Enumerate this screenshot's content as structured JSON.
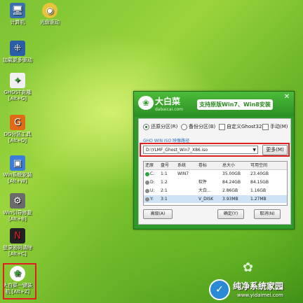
{
  "desktop": {
    "icons": [
      {
        "label": "计算机",
        "icon": "computer-icon"
      },
      {
        "label": "光盘驱动",
        "icon": "disc-icon"
      },
      {
        "label": "加载更多驱动",
        "icon": "grid-icon"
      },
      {
        "label": "GHOST克隆 [Alt+G]",
        "icon": "ghost-icon"
      },
      {
        "label": "DG分区工具 [Alt+D]",
        "icon": "dg-icon"
      },
      {
        "label": "Win系统安装 [Alt+W]",
        "icon": "windows-install-icon"
      },
      {
        "label": "Win引导修复 [Alt+B]",
        "icon": "repair-icon"
      },
      {
        "label": "登录密码清除 [Alt+C]",
        "icon": "password-clear-icon"
      },
      {
        "label": "大白菜一键装机 [Alt+Z]",
        "icon": "dabaicai-install-icon"
      }
    ]
  },
  "window": {
    "brand": "大白菜",
    "brand_sub": "dabaicai.com",
    "slogan": "支持原版Win7、Win8安装",
    "close_symbol": "✕",
    "options": {
      "restore": "还原分区(R)",
      "backup": "备份分区(B)",
      "custom_ghost": "自定义Ghost32",
      "manual": "手动(M)"
    },
    "path_label": "GHO WIN ISO 映像路径",
    "path_value": "D:\\YLMF_Ghost_Win7_X86.iso",
    "more_button": "更多(M)",
    "table": {
      "headers": [
        "还原",
        "盘号",
        "系统",
        "卷标",
        "总大小",
        "可用空间"
      ],
      "rows": [
        {
          "drive": "C:",
          "num": "1:1",
          "os": "WIN7",
          "label": "",
          "total": "35.00GB",
          "free": "23.40GB",
          "icon_color": "#27a83a",
          "selected": false
        },
        {
          "drive": "D:",
          "num": "1:2",
          "os": "",
          "label": "软件",
          "total": "84.24GB",
          "free": "84.15GB",
          "icon_color": "#888888",
          "selected": false
        },
        {
          "drive": "U:",
          "num": "2:1",
          "os": "",
          "label": "大白...",
          "total": "2.86GB",
          "free": "1.16GB",
          "icon_color": "#888888",
          "selected": false
        },
        {
          "drive": "Y:",
          "num": "3:1",
          "os": "",
          "label": "V_DISK",
          "total": "3.93MB",
          "free": "1.27MB",
          "icon_color": "#888888",
          "selected": true
        }
      ]
    },
    "buttons": {
      "advanced": "高级(A)",
      "ok": "确定(Y)",
      "cancel": "取消(N)"
    }
  },
  "watermark": {
    "name": "纯净系统家园",
    "url": "www.yidaimei.com"
  },
  "colors": {
    "window_green": "#2f9a2a",
    "highlight_red": "#e02020"
  }
}
